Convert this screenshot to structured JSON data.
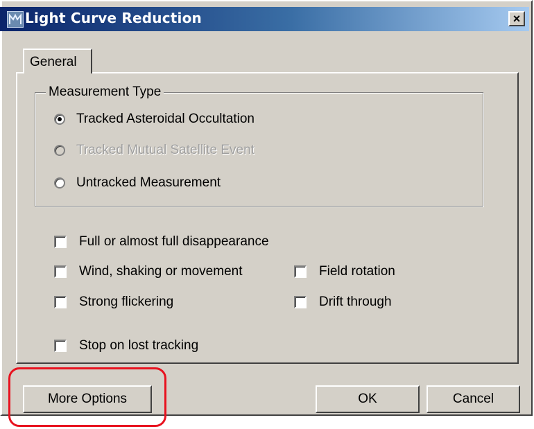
{
  "window": {
    "title": "Light Curve Reduction",
    "close_label": "×"
  },
  "tabs": [
    {
      "label": "General"
    }
  ],
  "measurement_type": {
    "label": "Measurement Type",
    "options": [
      {
        "label": "Tracked Asteroidal Occultation",
        "selected": true,
        "enabled": true
      },
      {
        "label": "Tracked Mutual Satellite Event",
        "selected": false,
        "enabled": false
      },
      {
        "label": "Untracked Measurement",
        "selected": false,
        "enabled": true
      }
    ]
  },
  "checks": {
    "full_disappearance": "Full or almost full disappearance",
    "wind": "Wind, shaking or movement",
    "field_rotation": "Field rotation",
    "flickering": "Strong flickering",
    "drift": "Drift through",
    "stop_lost": "Stop on lost tracking"
  },
  "buttons": {
    "more_options": "More Options",
    "ok": "OK",
    "cancel": "Cancel"
  },
  "colors": {
    "highlight": "#e8121f",
    "title_gradient_start": "#0a246a",
    "title_gradient_end": "#a6caf0"
  }
}
